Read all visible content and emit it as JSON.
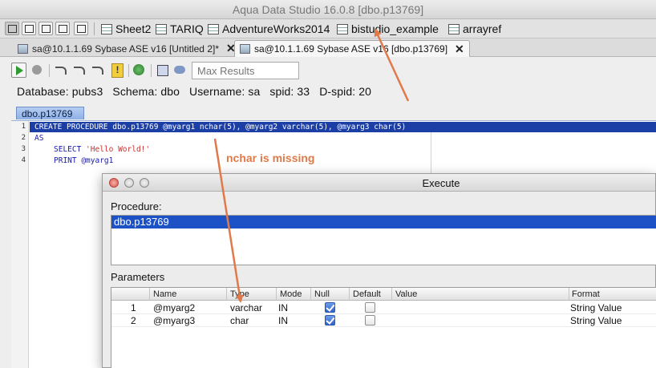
{
  "window": {
    "title": "Aqua Data Studio 16.0.8 [dbo.p13769]"
  },
  "workspace_tabs": [
    {
      "label": "Sheet2"
    },
    {
      "label": "TARIQ"
    },
    {
      "label": "AdventureWorks2014"
    },
    {
      "label": "bistudio_example"
    },
    {
      "label": "arrayref"
    }
  ],
  "editor_tabs": [
    {
      "label": "sa@10.1.1.69 Sybase ASE v16 [Untitled 2]*",
      "close": "✕"
    },
    {
      "label": "sa@10.1.1.69 Sybase ASE v16 [dbo.p13769]",
      "close": "✕"
    }
  ],
  "toolbar": {
    "max_results_placeholder": "Max Results"
  },
  "connection_info": {
    "database_label": "Database:",
    "database": "pubs3",
    "schema_label": "Schema:",
    "schema": "dbo",
    "username_label": "Username:",
    "username": "sa",
    "spid_label": "spid:",
    "spid": "33",
    "dspid_label": "D-spid:",
    "dspid": "20"
  },
  "editor": {
    "doc_tab": "dbo.p13769",
    "lines": [
      {
        "num": "1",
        "text": "CREATE PROCEDURE dbo.p13769 @myarg1 nchar(5), @myarg2 varchar(5), @myarg3 char(5)"
      },
      {
        "num": "2",
        "text": "AS"
      },
      {
        "num": "3",
        "kw": "SELECT ",
        "str": "'Hello World!'"
      },
      {
        "num": "4",
        "text": "PRINT @myarg1"
      }
    ]
  },
  "annotation": {
    "text": "nchar is missing",
    "color": "#e07a4a"
  },
  "dialog": {
    "title": "Execute",
    "procedure_label": "Procedure:",
    "procedure_selected": "dbo.p13769",
    "parameters_label": "Parameters",
    "columns": [
      "Name",
      "Type",
      "Mode",
      "Null",
      "Default",
      "Value",
      "Format"
    ],
    "rows": [
      {
        "index": "1",
        "name": "@myarg2",
        "type": "varchar",
        "mode": "IN",
        "null": true,
        "default": false,
        "value": "",
        "format": "String Value"
      },
      {
        "index": "2",
        "name": "@myarg3",
        "type": "char",
        "mode": "IN",
        "null": true,
        "default": false,
        "value": "",
        "format": "String Value"
      }
    ]
  },
  "colors": {
    "selection": "#1c3fa6",
    "list_selection": "#1d52c7",
    "arrow": "#e07a4a"
  }
}
